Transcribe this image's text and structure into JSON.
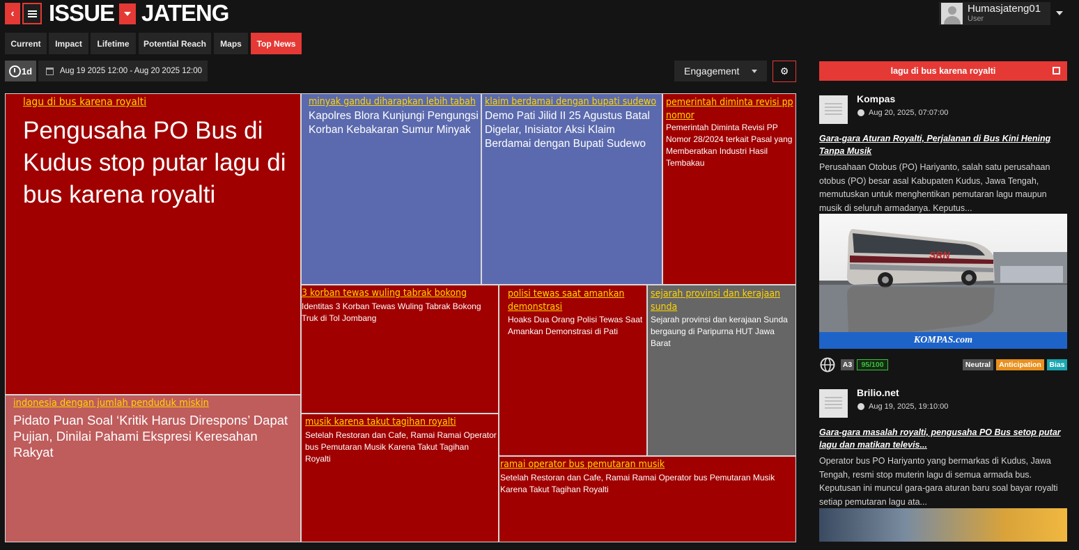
{
  "app": {
    "logo_left": "ISSUE",
    "logo_right": "JATENG",
    "back_icon": "chevron-left-icon",
    "menu_icon": "hamburger-icon"
  },
  "user": {
    "name": "Humasjateng01",
    "role": "User"
  },
  "tabs": [
    {
      "label": "Current",
      "active": false
    },
    {
      "label": "Impact",
      "active": false
    },
    {
      "label": "Lifetime",
      "active": false
    },
    {
      "label": "Potential Reach",
      "active": false
    },
    {
      "label": "Maps",
      "active": false
    },
    {
      "label": "Top News",
      "active": true
    }
  ],
  "filters": {
    "period": "1d",
    "date_range": "Aug 19 2025 12:00 - Aug 20 2025 12:00",
    "metric": "Engagement"
  },
  "colors": {
    "accent": "#e53935",
    "tile_red": "#a00000",
    "tile_blue": "#5b6aae",
    "tile_gray": "#666666",
    "tile_pink": "#bf5c5c",
    "topic_yellow": "#ffd400"
  },
  "treemap": [
    {
      "topic": "lagu di bus karena royalti",
      "title": "Pengusaha PO Bus di Kudus stop putar lagu di bus karena royalti"
    },
    {
      "topic": "indonesia dengan jumlah penduduk miskin",
      "title": "Pidato Puan Soal ‘Kritik Harus Direspons’ Dapat Pujian, Dinilai Pahami Ekspresi Keresahan Rakyat"
    },
    {
      "topic": "minyak gandu diharapkan lebih tabah",
      "title": "Kapolres Blora Kunjungi Pengungsi Korban Kebakaran Sumur Minyak"
    },
    {
      "topic": "klaim berdamai dengan bupati sudewo",
      "title": "Demo Pati Jilid II 25 Agustus Batal Digelar, Inisiator Aksi Klaim Berdamai dengan Bupati Sudewo"
    },
    {
      "topic": "pemerintah diminta revisi pp nomor",
      "title": "Pemerintah Diminta Revisi PP Nomor 28/2024 terkait Pasal yang Memberatkan Industri Hasil Tembakau"
    },
    {
      "topic": "3 korban tewas wuling tabrak bokong",
      "title": "Identitas 3 Korban Tewas Wuling Tabrak Bokong Truk di Tol Jombang"
    },
    {
      "topic": "polisi tewas saat amankan demonstrasi",
      "title": "Hoaks Dua Orang Polisi Tewas Saat Amankan Demonstrasi di Pati"
    },
    {
      "topic": "sejarah provinsi dan kerajaan sunda",
      "title": "Sejarah provinsi dan kerajaan Sunda bergaung di Paripurna HUT Jawa Barat"
    },
    {
      "topic": "musik karena takut tagihan royalti",
      "title": "Setelah Restoran dan Cafe, Ramai Ramai Operator bus Pemutaran Musik Karena Takut Tagihan Royalti"
    },
    {
      "topic": "ramai operator bus pemutaran musik",
      "title": "Setelah Restoran dan Cafe, Ramai Ramai Operator bus Pemutaran Musik Karena Takut Tagihan Royalti"
    }
  ],
  "right_panel": {
    "header": "lagu di bus karena royalti",
    "news": [
      {
        "source": "Kompas",
        "date": "Aug 20, 2025, 07:07:00",
        "headline": "Gara-gara Aturan Royalti, Perjalanan di Bus Kini Hening Tanpa Musik",
        "summary": "Perusahaan Otobus (PO) Hariyanto, salah satu perusahaan otobus (PO) besar asal Kabupaten Kudus, Jawa Tengah, memutuskan untuk menghentikan pemutaran lagu maupun musik di seluruh armadanya. Keputus...",
        "image_watermark": "KOMPAS.com",
        "bus_livery": "SRN",
        "rank": "A3",
        "score": "95/100",
        "tags": [
          "Neutral",
          "Anticipation",
          "Bias"
        ]
      },
      {
        "source": "Brilio.net",
        "date": "Aug 19, 2025, 19:10:00",
        "headline": "Gara-gara masalah royalti, pengusaha PO Bus setop putar lagu dan matikan televis...",
        "summary": "Operator bus PO Hariyanto yang bermarkas di Kudus, Jawa Tengah, resmi stop muterin lagu di semua armada bus. Keputusan ini muncul gara-gara aturan baru soal bayar royalti setiap pemutaran lagu ata..."
      }
    ]
  }
}
